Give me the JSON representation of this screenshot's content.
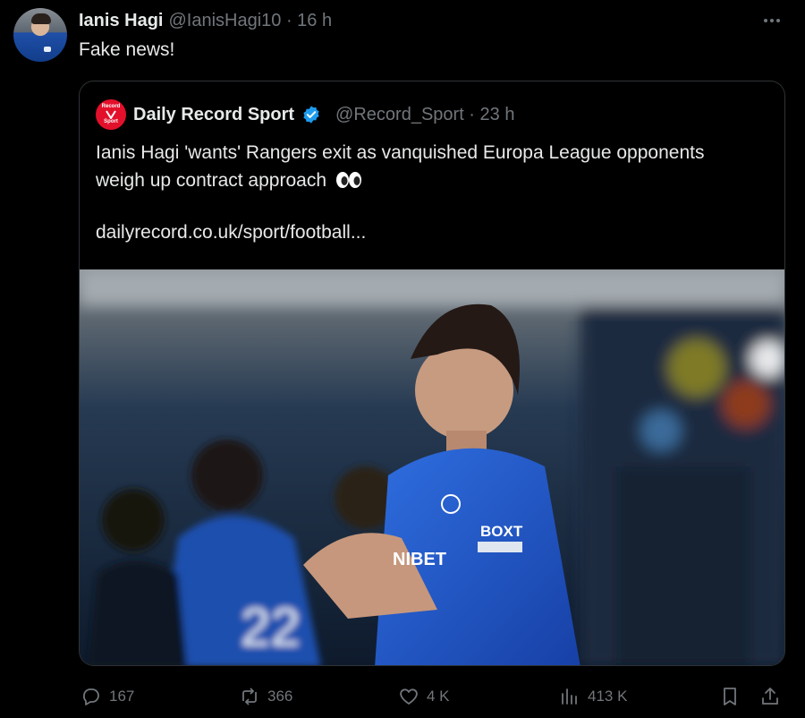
{
  "tweet": {
    "author_name": "Ianis Hagi",
    "author_handle": "@IanisHagi10 · 16 h",
    "text": "Fake news!",
    "more_icon": "more-icon"
  },
  "quote": {
    "author_name": "Daily Record Sport",
    "author_handle": "@Record_Sport · 23 h",
    "text": "Ianis Hagi 'wants' Rangers exit as vanquished Europa League opponents weigh up contract approach",
    "link": "dailyrecord.co.uk/sport/football...",
    "logo_text": "Record Sport",
    "accent_color": "#1d9bf0",
    "logo_color": "#e3102b"
  },
  "actions": {
    "replies": "167",
    "reposts": "366",
    "likes": "4 K",
    "views": "413 K"
  }
}
